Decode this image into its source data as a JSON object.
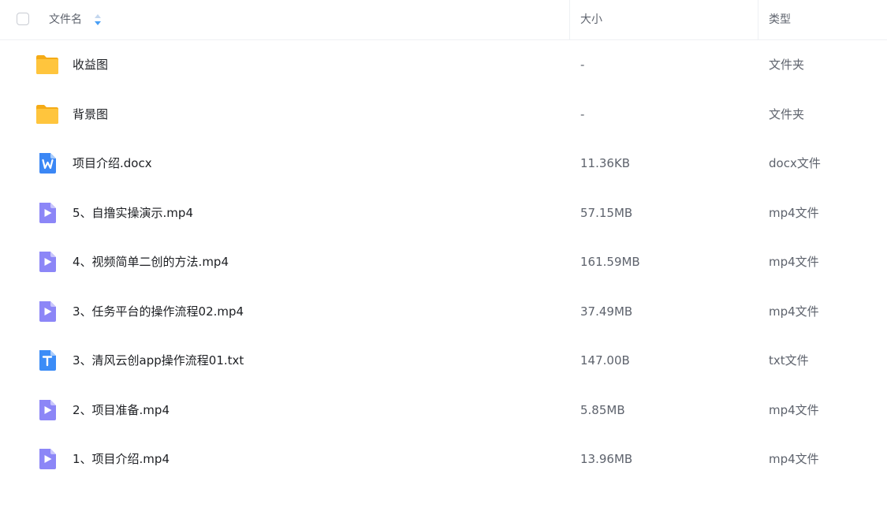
{
  "header": {
    "name_label": "文件名",
    "size_label": "大小",
    "type_label": "类型",
    "sort_icon": "sort-arrows-icon",
    "accent_color": "#4a9ff5"
  },
  "files": [
    {
      "icon": "folder-icon",
      "name": "收益图",
      "size": "-",
      "type": "文件夹"
    },
    {
      "icon": "folder-icon",
      "name": "背景图",
      "size": "-",
      "type": "文件夹"
    },
    {
      "icon": "word-doc-icon",
      "name": "项目介绍.docx",
      "size": "11.36KB",
      "type": "docx文件"
    },
    {
      "icon": "video-icon",
      "name": "5、自撸实操演示.mp4",
      "size": "57.15MB",
      "type": "mp4文件"
    },
    {
      "icon": "video-icon",
      "name": "4、视频简单二创的方法.mp4",
      "size": "161.59MB",
      "type": "mp4文件"
    },
    {
      "icon": "video-icon",
      "name": "3、任务平台的操作流程02.mp4",
      "size": "37.49MB",
      "type": "mp4文件"
    },
    {
      "icon": "text-doc-icon",
      "name": "3、清风云创app操作流程01.txt",
      "size": "147.00B",
      "type": "txt文件"
    },
    {
      "icon": "video-icon",
      "name": "2、项目准备.mp4",
      "size": "5.85MB",
      "type": "mp4文件"
    },
    {
      "icon": "video-icon",
      "name": "1、项目介绍.mp4",
      "size": "13.96MB",
      "type": "mp4文件"
    }
  ],
  "colors": {
    "folder": "#ffc53d",
    "word": "#3b87f5",
    "video": "#8c86f7",
    "text": "#3b8cf7"
  }
}
